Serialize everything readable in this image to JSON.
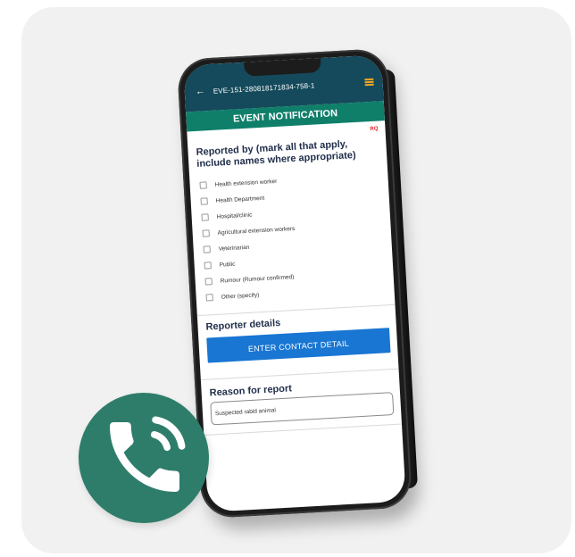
{
  "appbar": {
    "back_icon": "back-arrow-icon",
    "event_id": "EVE-151-280818171834-758-1",
    "menu_icon": "hamburger-menu-icon",
    "menu_icon_color": "#f5a623",
    "background": "#144a5b"
  },
  "form": {
    "title": "EVENT NOTIFICATION",
    "title_background": "#0f7f6a",
    "required_tag": "RQ",
    "reported_by": {
      "heading": "Reported by (mark all that apply, include names where appropriate)",
      "options": [
        "Health extension worker",
        "Health Department",
        "Hospital/clinic",
        "Agricultural extension workers",
        "Veterinarian",
        "Public",
        "Rumour (Rumour confirmed)",
        "Other (specify)"
      ]
    },
    "reporter_details": {
      "heading": "Reporter details",
      "button_label": "ENTER CONTACT DETAIL",
      "button_color": "#1976d2"
    },
    "reason": {
      "heading": "Reason for report",
      "value": "Suspected rabid animal"
    }
  },
  "call_badge": {
    "icon": "phone-call-icon",
    "color": "#2e7d6b"
  }
}
